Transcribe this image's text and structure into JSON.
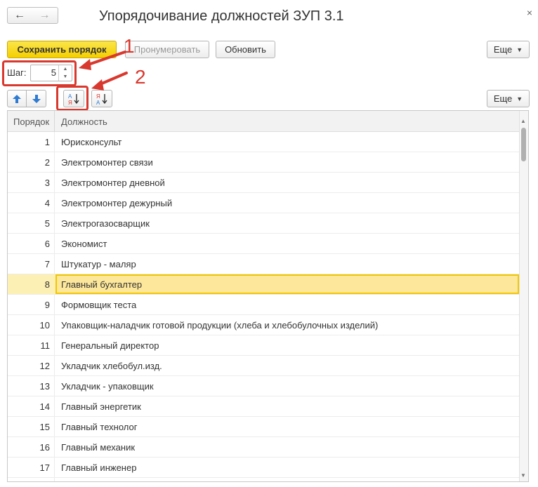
{
  "window": {
    "title": "Упорядочивание должностей ЗУП 3.1",
    "back_icon": "←",
    "forward_icon": "→",
    "close_icon": "×"
  },
  "toolbar": {
    "save_label": "Сохранить порядок",
    "renumber_label": "Пронумеровать",
    "refresh_label": "Обновить",
    "more_label": "Еще"
  },
  "step": {
    "label": "Шаг:",
    "value": "5"
  },
  "callouts": {
    "one": "1",
    "two": "2"
  },
  "table_toolbar": {
    "more_label": "Еще"
  },
  "table": {
    "columns": [
      "Порядок",
      "Должность"
    ],
    "selected_index": 7,
    "rows": [
      {
        "num": "1",
        "name": "Юрисконсульт"
      },
      {
        "num": "2",
        "name": "Электромонтер связи"
      },
      {
        "num": "3",
        "name": "Электромонтер дневной"
      },
      {
        "num": "4",
        "name": "Электромонтер дежурный"
      },
      {
        "num": "5",
        "name": "Электрогазосварщик"
      },
      {
        "num": "6",
        "name": "Экономист"
      },
      {
        "num": "7",
        "name": "Штукатур - маляр"
      },
      {
        "num": "8",
        "name": "Главный бухгалтер"
      },
      {
        "num": "9",
        "name": "Формовщик теста"
      },
      {
        "num": "10",
        "name": "Упаковщик-наладчик готовой продукции (хлеба и хлебобулочных изделий)"
      },
      {
        "num": "11",
        "name": "Генеральный директор"
      },
      {
        "num": "12",
        "name": "Укладчик хлебобул.изд."
      },
      {
        "num": "13",
        "name": "Укладчик - упаковщик"
      },
      {
        "num": "14",
        "name": "Главный энергетик"
      },
      {
        "num": "15",
        "name": "Главный технолог"
      },
      {
        "num": "16",
        "name": "Главный механик"
      },
      {
        "num": "17",
        "name": "Главный инженер"
      }
    ]
  },
  "colors": {
    "accent_yellow": "#f4cf00",
    "annotation_red": "#d9382e",
    "selection": "#fde79a",
    "arrow_blue": "#2e7bd1"
  }
}
